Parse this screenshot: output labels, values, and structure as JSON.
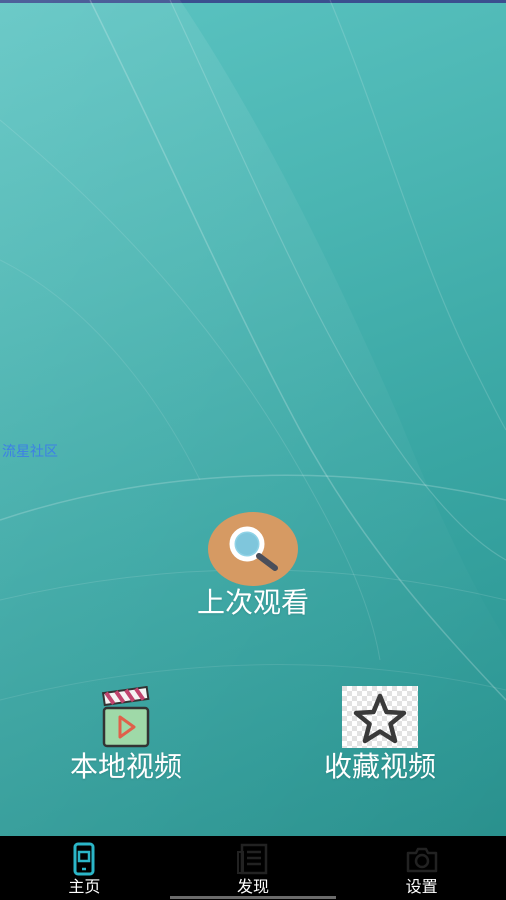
{
  "app": {
    "community_link": "流星社区"
  },
  "main": {
    "last_watched_label": "上次观看",
    "local_video_label": "本地视频",
    "favorite_video_label": "收藏视频"
  },
  "bottom_nav": {
    "items": [
      {
        "label": "主页",
        "icon": "phone-icon"
      },
      {
        "label": "发现",
        "icon": "newspaper-icon"
      },
      {
        "label": "设置",
        "icon": "camera-icon"
      }
    ]
  },
  "colors": {
    "background": "#3aa7a4",
    "search_circle": "#d69a63",
    "link": "#3d7fe6",
    "nav_bg": "#000000",
    "nav_home_icon": "#2bb6c8"
  }
}
